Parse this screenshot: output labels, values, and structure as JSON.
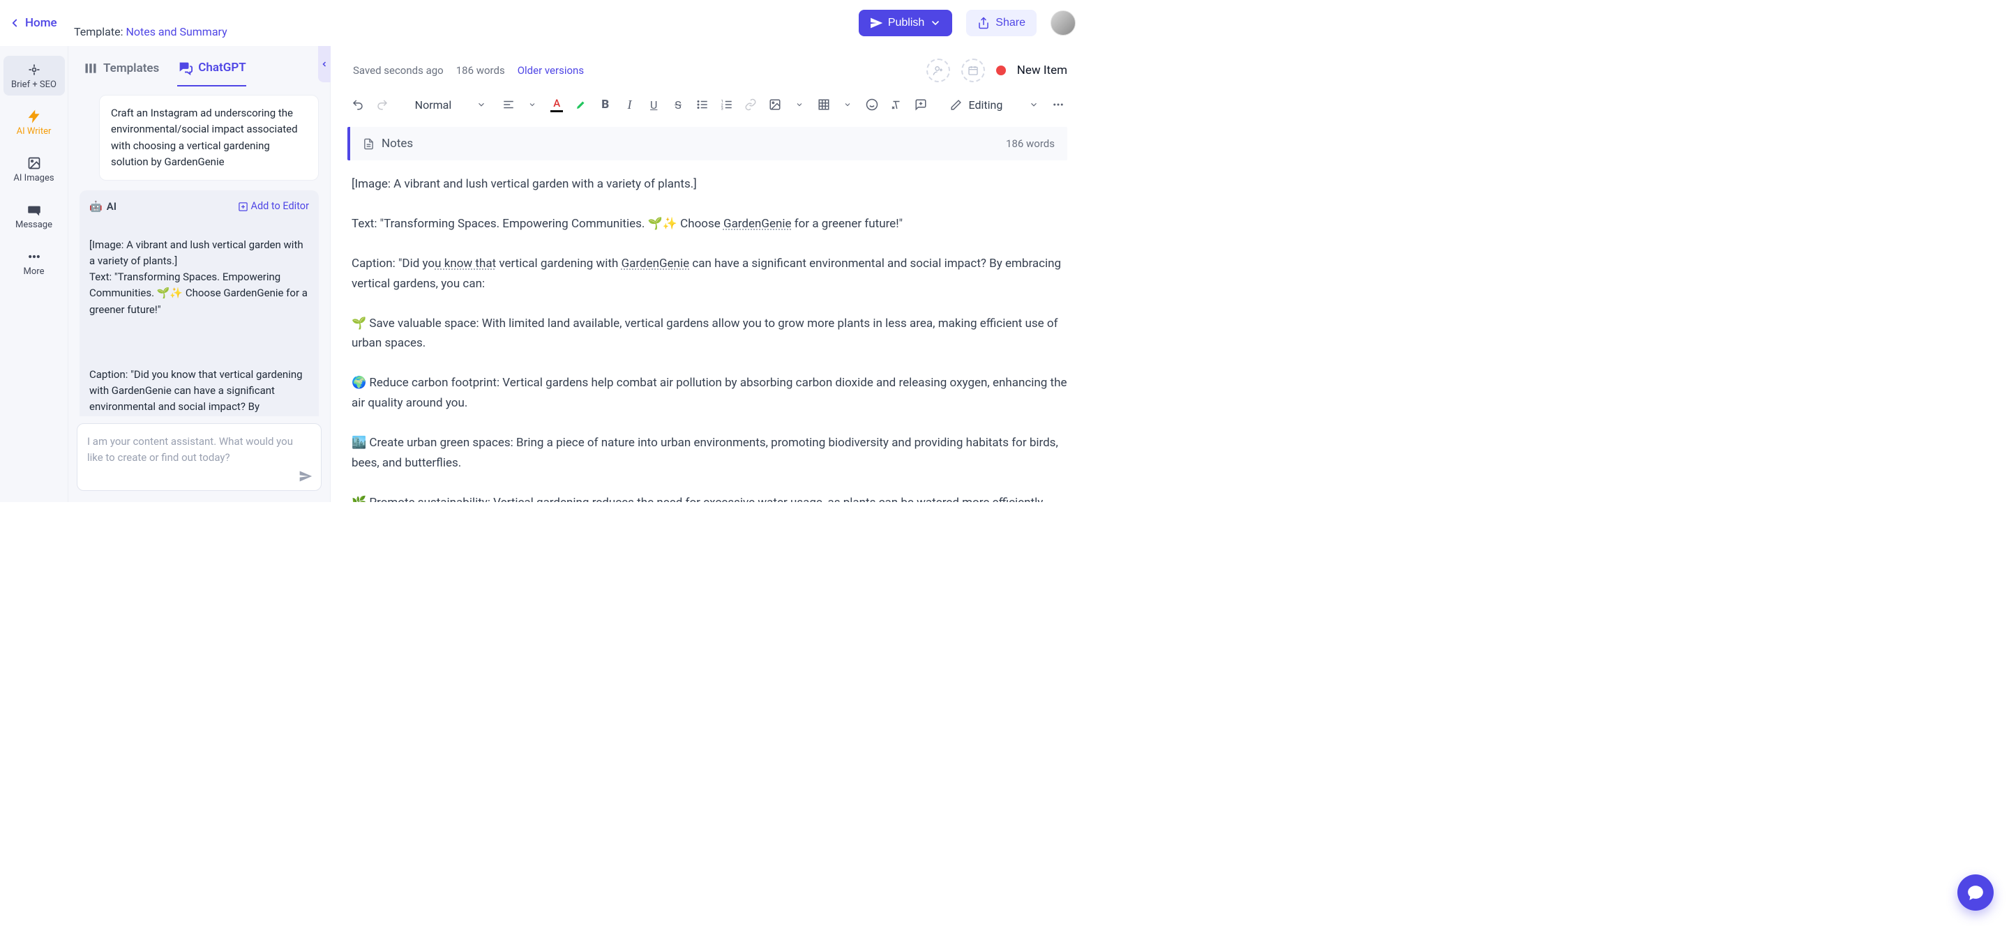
{
  "topbar": {
    "home": "Home",
    "template_prefix": "Template: ",
    "template_name": "Notes and Summary",
    "publish": "Publish",
    "share": "Share"
  },
  "rail": [
    {
      "label": "Brief + SEO",
      "icon": "target-icon"
    },
    {
      "label": "AI Writer",
      "icon": "bolt-icon"
    },
    {
      "label": "AI Images",
      "icon": "image-icon"
    },
    {
      "label": "Message",
      "icon": "chat-icon"
    },
    {
      "label": "More",
      "icon": "dots-icon"
    }
  ],
  "sidepanel": {
    "tabs": {
      "templates": "Templates",
      "chatgpt": "ChatGPT"
    },
    "user_msg": "Craft an Instagram ad underscoring the environmental/social impact associated with choosing a vertical gardening solution by GardenGenie",
    "ai_label": "AI",
    "add_to_editor": "Add to Editor",
    "ai_msg_p1": "[Image: A vibrant and lush vertical garden with a variety of plants.]\nText: \"Transforming Spaces. Empowering Communities. 🌱✨ Choose GardenGenie for a greener future!\"",
    "ai_msg_p2": "Caption: \"Did you know that vertical gardening with GardenGenie can have a significant environmental and social impact? By embracing vertical gardens, you can:",
    "input_placeholder": "I am your content assistant. What would you like to create or find out today?"
  },
  "editor": {
    "saved": "Saved seconds ago",
    "word_count_top": "186 words",
    "older": "Older versions",
    "new_item": "New Item",
    "style_select": "Normal",
    "editing_mode": "Editing",
    "notes_title": "Notes",
    "notes_wc": "186 words",
    "paragraphs": {
      "p1": "[Image: A vibrant and lush vertical garden with a variety of plants.]",
      "p2a": "Text: \"Transforming Spaces. Empowering Communities. 🌱✨ Choose ",
      "p2b": "GardenGenie",
      "p2c": " for a greener future!\"",
      "p3a": "Caption: \"Did yo",
      "p3b": "u know that",
      "p3c": " vertical gardening with ",
      "p3d": "GardenGenie",
      "p3e": " can have a significant environmental and social impact? By embracing vertical gardens, you can:",
      "p4": "🌱 Save valuable space: With limited land available, vertical gardens allow you to grow more plants in less area, making efficient use of urban spaces.",
      "p5": "🌍 Reduce carbon footprint: Vertical gardens help combat air pollution by absorbing carbon dioxide and releasing oxygen, enhancing the air quality around you.",
      "p6": "🏙️ Create urban green spaces: Bring a piece of nature into urban environments, promoting biodiversity and providing habitats for birds, bees, and butterflies.",
      "p7a": "🌿 Promote sustainability: Vertical gardening reduces the need for excessive ",
      "p7b": "water ",
      "p7c": "usage, as plants can be watered more efficiently,"
    }
  }
}
